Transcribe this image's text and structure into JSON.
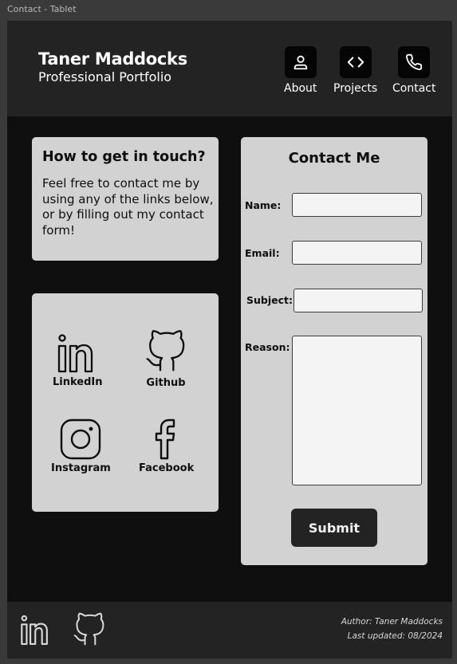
{
  "window": {
    "frame_title": "Contact - Tablet"
  },
  "header": {
    "name": "Taner Maddocks",
    "subtitle": "Professional Portfolio",
    "nav": [
      {
        "label": "About",
        "icon": "user-icon"
      },
      {
        "label": "Projects",
        "icon": "code-icon"
      },
      {
        "label": "Contact",
        "icon": "phone-icon"
      }
    ]
  },
  "touch": {
    "title": "How to get in touch?",
    "text": "Feel free to contact me by using any of the links below, or by filling out my contact form!"
  },
  "social": [
    {
      "label": "LinkedIn",
      "icon": "linkedin-icon"
    },
    {
      "label": "Github",
      "icon": "github-icon"
    },
    {
      "label": "Instagram",
      "icon": "instagram-icon"
    },
    {
      "label": "Facebook",
      "icon": "facebook-icon"
    }
  ],
  "contact_form": {
    "title": "Contact Me",
    "name_label": "Name:",
    "email_label": "Email:",
    "subject_label": "Subject:",
    "reason_label": "Reason:",
    "name_value": "",
    "email_value": "",
    "subject_value": "",
    "reason_value": "",
    "submit_label": "Submit"
  },
  "footer": {
    "author": "Author: Taner Maddocks",
    "updated": "Last updated: 08/2024",
    "icons": [
      "linkedin-icon",
      "github-icon"
    ]
  },
  "colors": {
    "page_bg": "#0f0f0f",
    "header_bg": "#232323",
    "card_bg": "#d2d2d2",
    "input_bg": "#f4f4f4",
    "button_bg": "#232323"
  }
}
